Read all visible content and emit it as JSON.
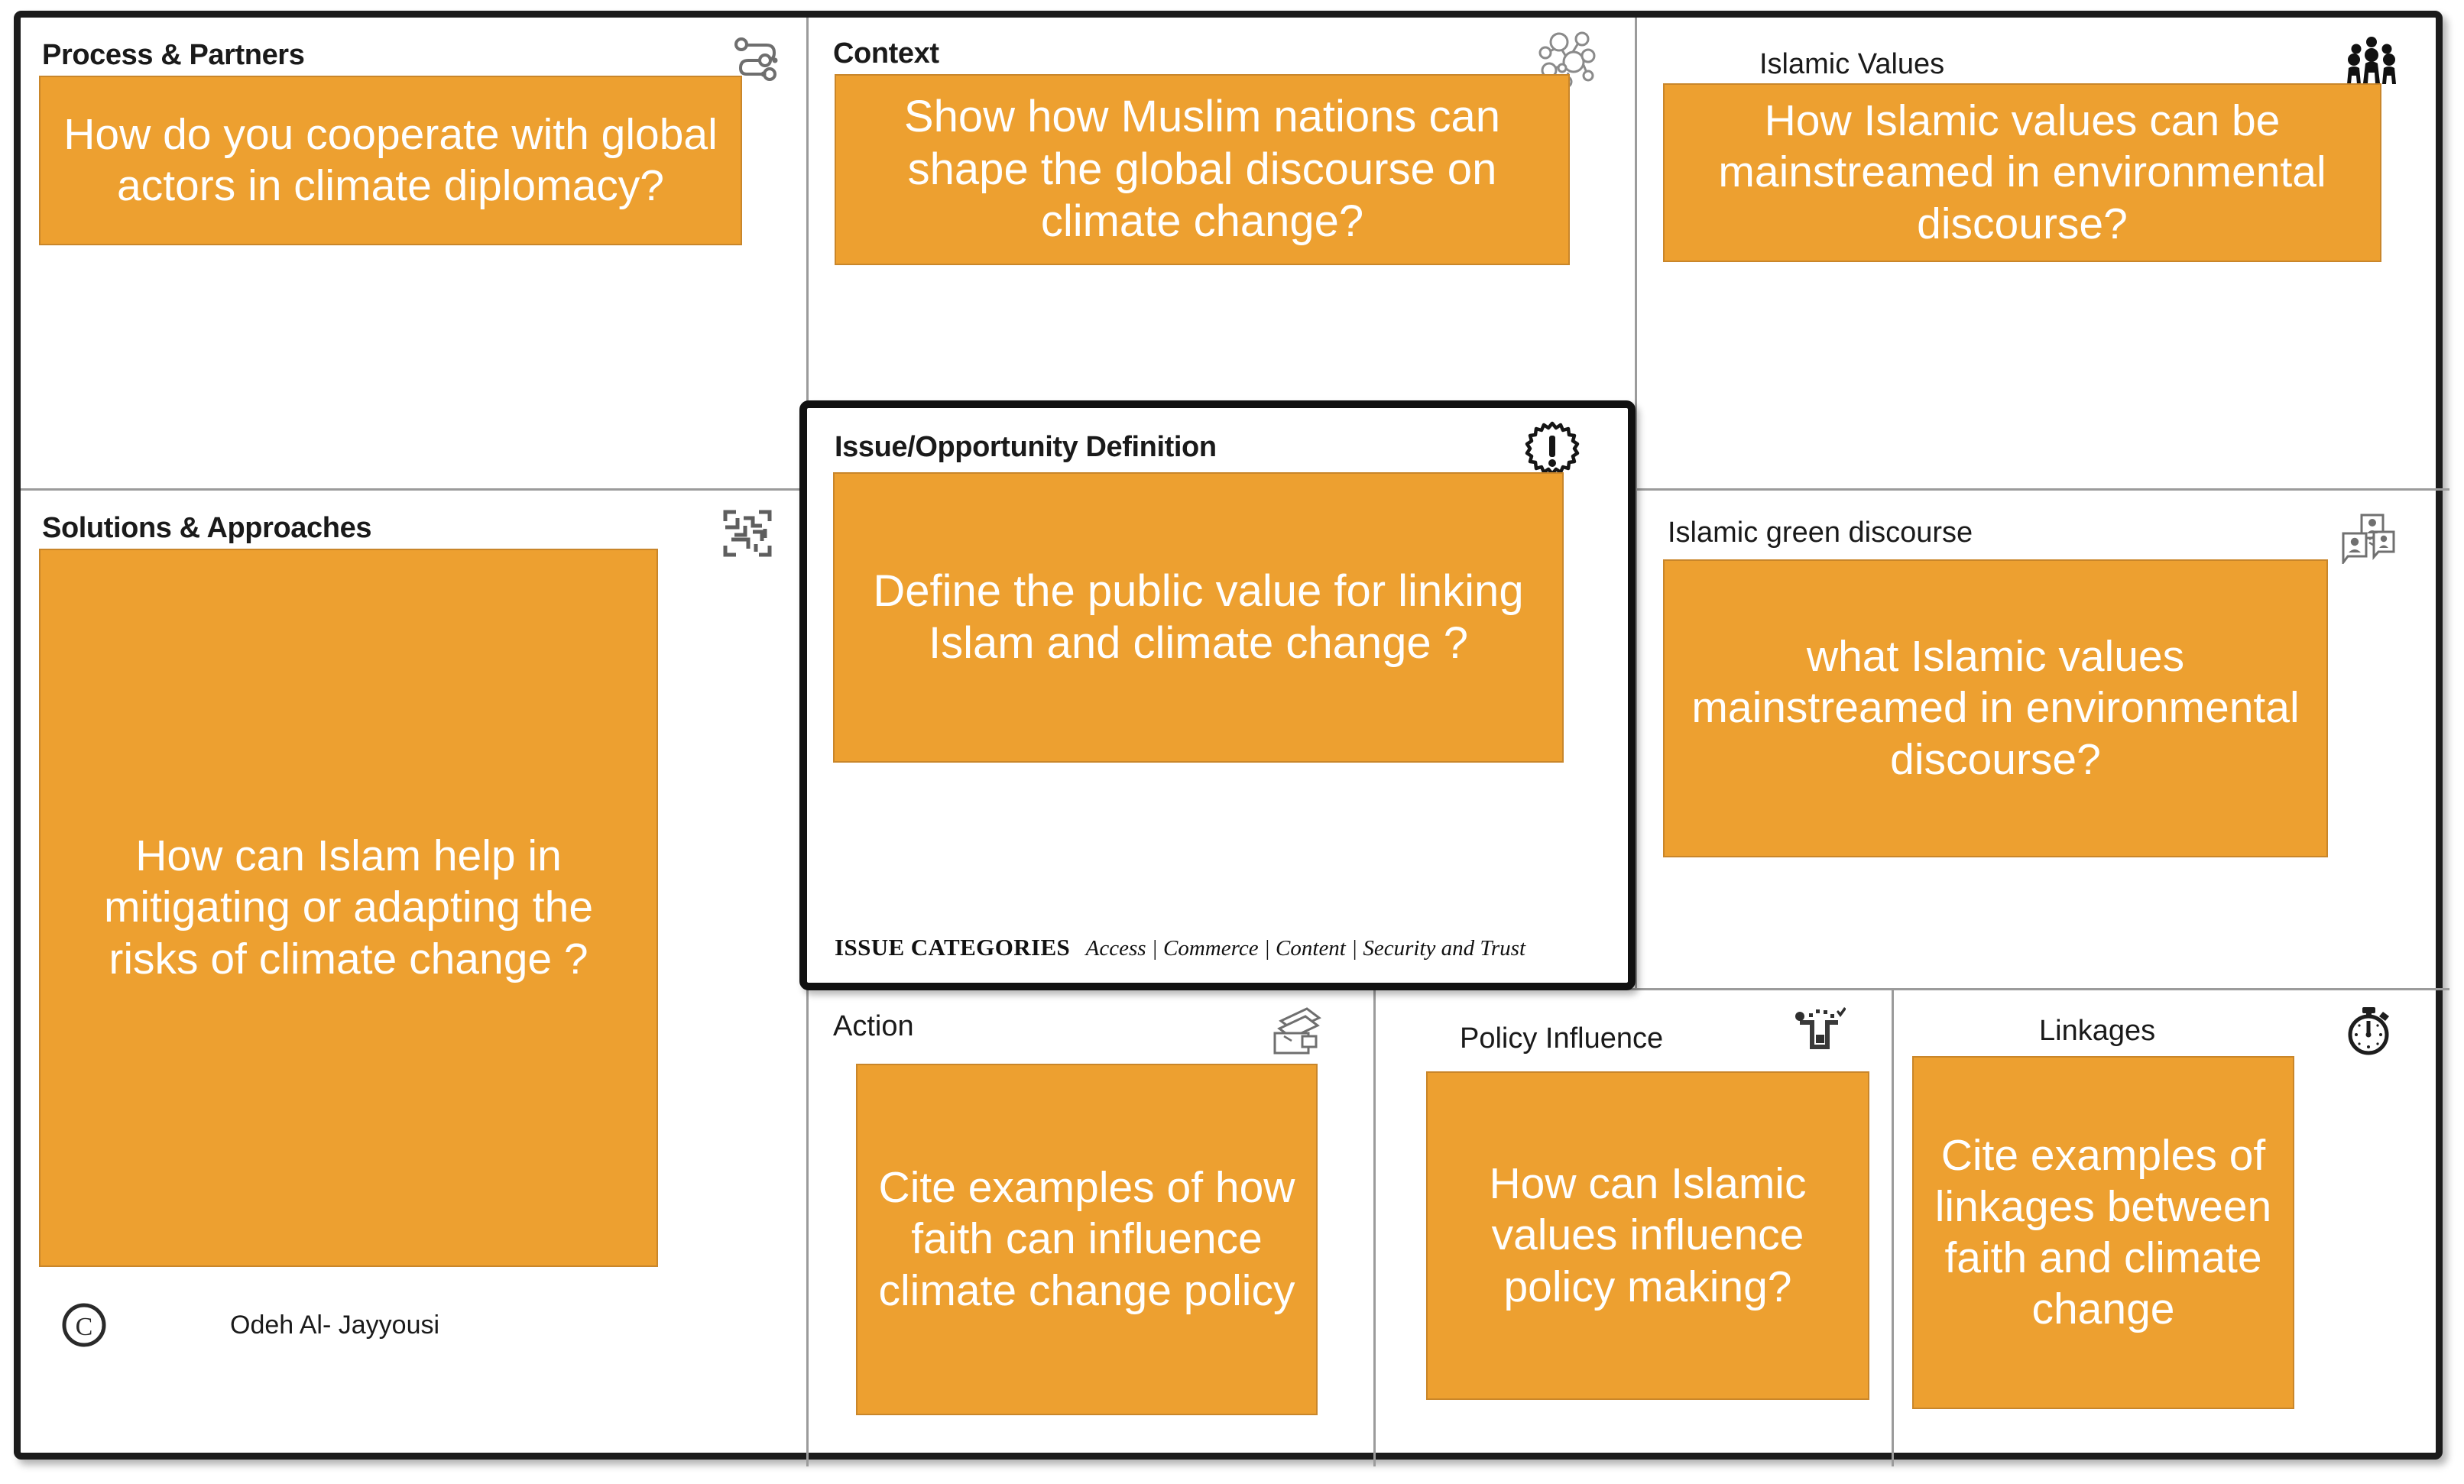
{
  "meta": {
    "title": "Public Value Canvas - Islam and Climate Change",
    "accent_color": "#eda030",
    "sticky_border_color": "#c9862a",
    "frame_color": "#1b1b1b",
    "text_on_sticky": "#ffffff"
  },
  "panels": {
    "process_partners": {
      "title": "Process & Partners",
      "icon": "process-flow-icon",
      "sticky": "How do you cooperate with global actors in climate diplomacy?"
    },
    "context": {
      "title": "Context",
      "icon": "network-nodes-icon",
      "sticky": "Show how  Muslim nations can shape the global discourse on climate change?"
    },
    "islamic_values": {
      "title": "Islamic Values",
      "icon": "three-people-icon",
      "sticky": "How Islamic values can be mainstreamed in environmental discourse?"
    },
    "solutions_approaches": {
      "title": "Solutions & Approaches",
      "icon": "maze-icon",
      "sticky": "How can Islam help in mitigating or adapting the risks of climate change ?"
    },
    "issue_opportunity": {
      "title": "Issue/Opportunity Definition",
      "icon": "exclamation-burst-icon",
      "sticky": "Define the public value for linking Islam and climate change ?",
      "categories_label": "ISSUE CATEGORIES",
      "categories_list": "Access  |  Commerce  |  Content  |  Security and Trust"
    },
    "islamic_green_discourse": {
      "title": "Islamic green discourse",
      "icon": "profile-cards-icon",
      "sticky": "what Islamic values mainstreamed in environmental discourse?"
    },
    "action": {
      "title": "Action",
      "icon": "card-stack-icon",
      "sticky": "Cite examples of how faith can influence climate change policy"
    },
    "policy_influence": {
      "title": "Policy Influence",
      "icon": "ballot-box-icon",
      "sticky": "How can Islamic values influence policy making?"
    },
    "linkages": {
      "title": "Linkages",
      "icon": "stopwatch-icon",
      "sticky": "Cite examples of linkages between faith and climate change"
    }
  },
  "footer": {
    "copyright_icon": "copyright-icon",
    "author": "Odeh Al- Jayyousi"
  }
}
